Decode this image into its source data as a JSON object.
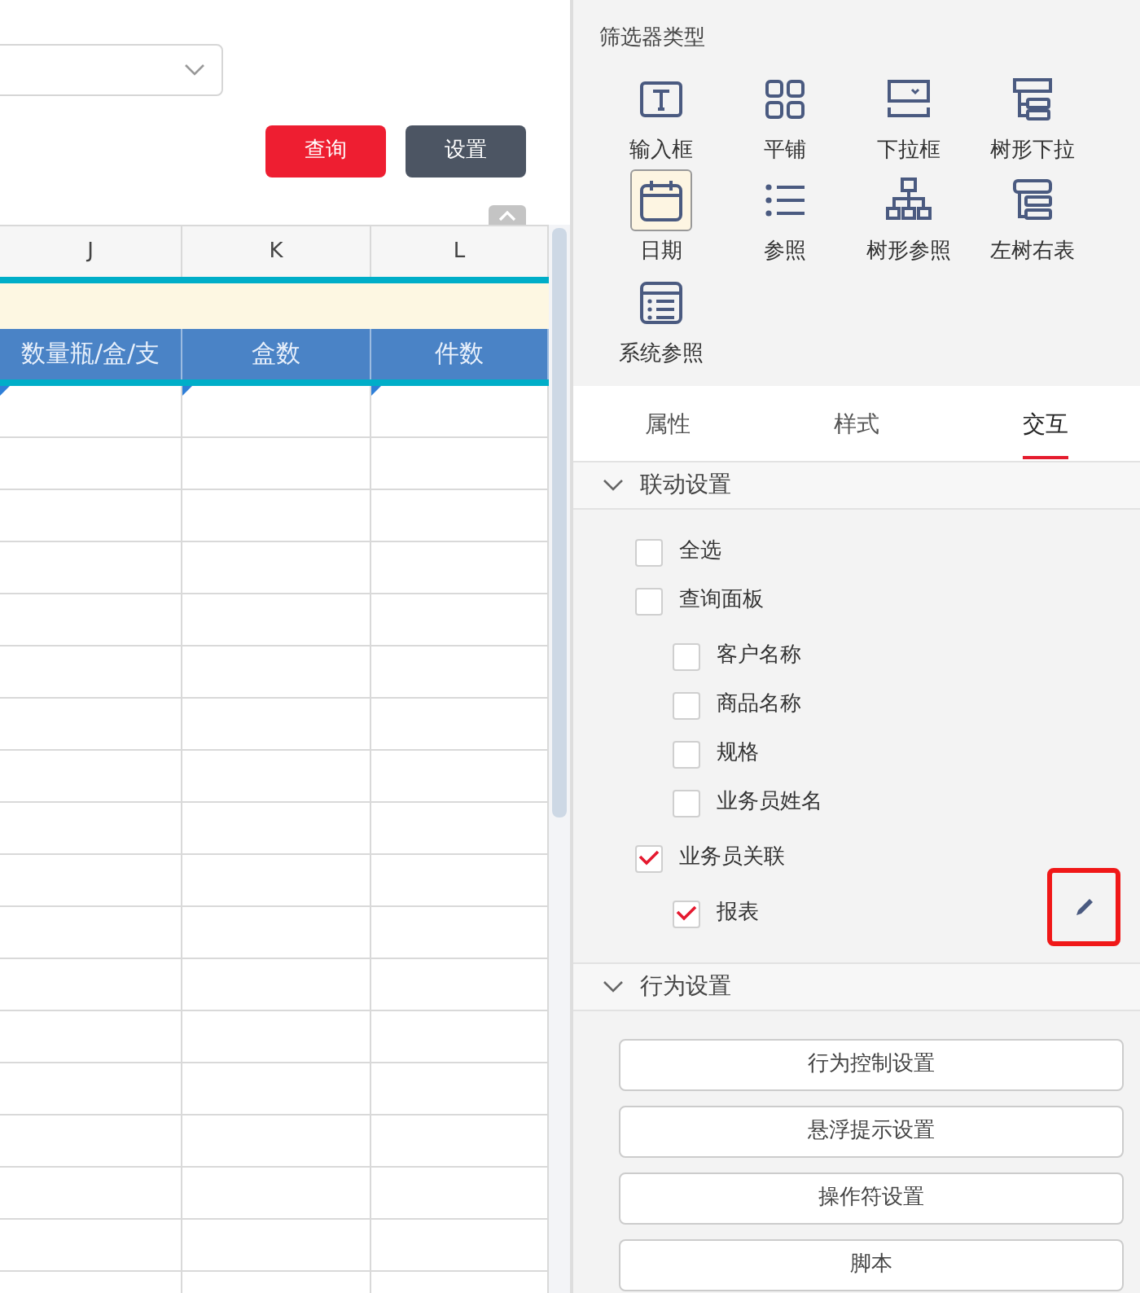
{
  "query_bar": {
    "buttons": [
      {
        "label": "查询",
        "kind": "primary"
      },
      {
        "label": "设置",
        "kind": "secondary"
      }
    ]
  },
  "sheet": {
    "column_letters": [
      "J",
      "K",
      "L"
    ],
    "header": [
      "数量瓶/盒/支",
      "盒数",
      "件数"
    ]
  },
  "filter_types": {
    "title": "筛选器类型",
    "items": [
      {
        "label": "输入框",
        "kind": "text",
        "selected": false
      },
      {
        "label": "平铺",
        "kind": "tile",
        "selected": false
      },
      {
        "label": "下拉框",
        "kind": "dropdown",
        "selected": false
      },
      {
        "label": "树形下拉",
        "kind": "treedrop",
        "selected": false
      },
      {
        "label": "日期",
        "kind": "date",
        "selected": true
      },
      {
        "label": "参照",
        "kind": "list",
        "selected": false
      },
      {
        "label": "树形参照",
        "kind": "tree",
        "selected": false
      },
      {
        "label": "左树右表",
        "kind": "treetable",
        "selected": false
      },
      {
        "label": "系统参照",
        "kind": "syslist",
        "selected": false
      }
    ]
  },
  "tabs": [
    {
      "label": "属性",
      "selected": false
    },
    {
      "label": "样式",
      "selected": false
    },
    {
      "label": "交互",
      "selected": true
    }
  ],
  "linkage": {
    "title": "联动设置",
    "expanded": true,
    "items": [
      {
        "label": "全选",
        "checked": false
      },
      {
        "label": "查询面板",
        "checked": false,
        "children": [
          {
            "label": "客户名称",
            "checked": false
          },
          {
            "label": "商品名称",
            "checked": false
          },
          {
            "label": "规格",
            "checked": false
          },
          {
            "label": "业务员姓名",
            "checked": false
          }
        ]
      },
      {
        "label": "业务员关联",
        "checked": true,
        "children": [
          {
            "label": "报表",
            "checked": true,
            "editable": true
          }
        ]
      }
    ]
  },
  "behavior": {
    "title": "行为设置",
    "expanded": true,
    "buttons": [
      "行为控制设置",
      "悬浮提示设置",
      "操作符设置",
      "脚本"
    ]
  }
}
